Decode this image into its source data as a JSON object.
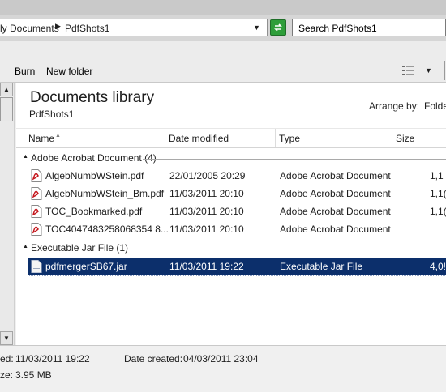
{
  "address": {
    "crumb_1": "ly Documents",
    "crumb_2": "PdfShots1",
    "search_placeholder": "Search PdfShots1"
  },
  "toolbar": {
    "burn": "Burn",
    "new_folder": "New folder"
  },
  "library": {
    "title": "Documents library",
    "subtitle": "PdfShots1",
    "arrange_label": "Arrange by:",
    "arrange_value": "Folde"
  },
  "columns": {
    "name": "Name",
    "date": "Date modified",
    "type": "Type",
    "size": "Size"
  },
  "groups": [
    {
      "label": "Adobe Acrobat Document (4)",
      "files": [
        {
          "name": "AlgebNumbWStein.pdf",
          "date": "22/01/2005 20:29",
          "type": "Adobe Acrobat Document",
          "size": "1,1"
        },
        {
          "name": "AlgebNumbWStein_Bm.pdf",
          "date": "11/03/2011 20:10",
          "type": "Adobe Acrobat Document",
          "size": "1,1("
        },
        {
          "name": "TOC_Bookmarked.pdf",
          "date": "11/03/2011 20:10",
          "type": "Adobe Acrobat Document",
          "size": "1,1("
        },
        {
          "name": "TOC4047483258068354 8...",
          "date": "11/03/2011 20:10",
          "type": "Adobe Acrobat Document",
          "size": ""
        }
      ]
    },
    {
      "label": "Executable Jar File (1)",
      "files": [
        {
          "name": "pdfmergerSB67.jar",
          "date": "11/03/2011 19:22",
          "type": "Executable Jar File",
          "size": "4,0!"
        }
      ]
    }
  ],
  "details": {
    "modified_label": "ed:",
    "modified_value": "11/03/2011 19:22",
    "created_label": "Date created:",
    "created_value": "04/03/2011 23:04",
    "size_label": "ze:",
    "size_value": "3.95 MB"
  },
  "colors": {
    "selection": "#0c2f6b",
    "refresh_green": "#2e9e3a",
    "pdf_red": "#c4161c"
  },
  "icons": [
    "refresh-icon",
    "views-icon",
    "pdf-file-icon",
    "jar-file-icon",
    "sort-up-icon",
    "collapse-triangle-icon"
  ]
}
